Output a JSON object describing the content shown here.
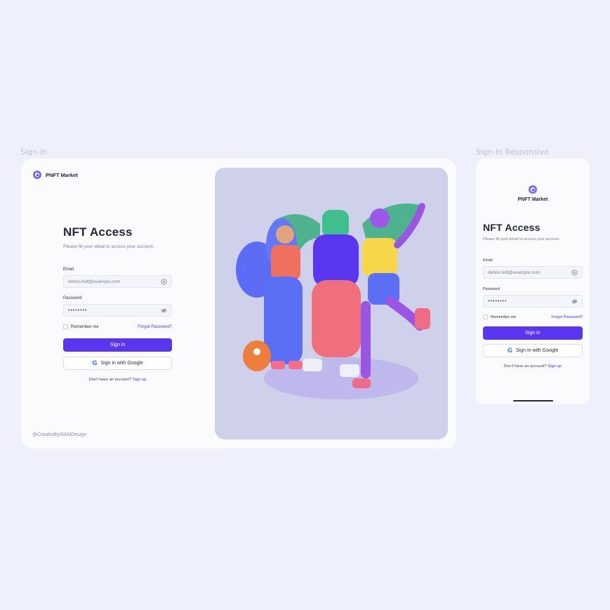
{
  "frame_labels": {
    "desktop": "Sign-In",
    "mobile": "Sign-In Responsive"
  },
  "brand": {
    "name": "PNFT Market",
    "icon": "pnft-logo-icon"
  },
  "form": {
    "title": "NFT Access",
    "subtitle": "Please fill your detail to access your account.",
    "email_label": "Email",
    "email_value": "debra.holt@example.com",
    "password_label": "Password",
    "password_value": "••••••••",
    "remember_label": "Remember me",
    "remember_checked": false,
    "forgot_label": "Forgot Password?",
    "signin_label": "Sign in",
    "google_label": "Sign in with Google",
    "signup_prompt": "Don't have an account?",
    "signup_link": "Sign up"
  },
  "credit": "@CreatedbyNAMDesign",
  "hero": {
    "description_icon": "nft-characters-illustration"
  },
  "colors": {
    "accent": "#5a36f1",
    "link": "#4c33e8",
    "background": "#eef0fc",
    "hero_bg": "#cfd0ea"
  }
}
